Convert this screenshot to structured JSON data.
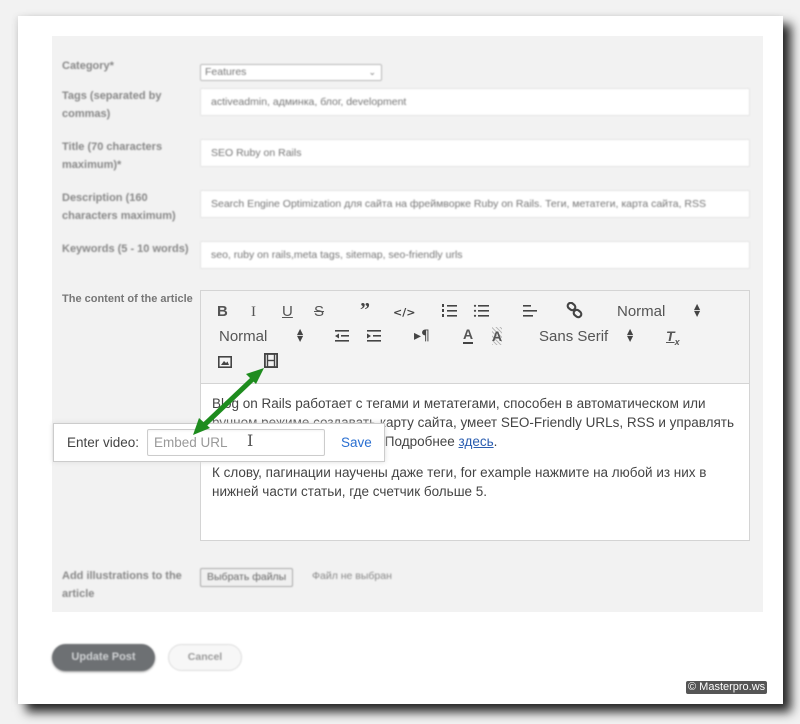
{
  "form": {
    "category": {
      "label": "Category*",
      "value": "Features"
    },
    "tags": {
      "label": "Tags (separated by commas)",
      "value": "activeadmin, админка, блог, development"
    },
    "title": {
      "label": "Title (70 characters maximum)*",
      "value": "SEO Ruby on Rails"
    },
    "description": {
      "label": "Description (160 characters maximum)",
      "value": "Search Engine Optimization для сайта на фреймворке Ruby on Rails. Теги, метатеги, карта сайта, RSS"
    },
    "keywords": {
      "label": "Keywords (5 - 10 words)",
      "value": "seo, ruby on rails,meta tags, sitemap, seo-friendly urls"
    },
    "content": {
      "label": "The content of the article"
    },
    "illustrations": {
      "label": "Add illustrations to the article",
      "button": "Выбрать файлы",
      "status": "Файл не выбран"
    }
  },
  "editor": {
    "toolbar": {
      "bold": "B",
      "italic": "I",
      "underline": "U",
      "strike": "S",
      "blockquote": "❞",
      "code": "</>",
      "header_select": "Normal",
      "size_select": "Normal",
      "font_select": "Sans Serif"
    },
    "paragraphs": [
      {
        "text": "Blog on Rails работает с тегами и метатегами, способен в автоматическом или ручном режиме создавать карту сайта, умеет SEO-Friendly URLs, RSS и управлять различными параметрами. Подробнее ",
        "link": "здесь",
        "after": "."
      },
      {
        "text": "К слову, пагинации научены даже теги, for example нажмите на любой из них в нижней части статьи, где счетчик больше 5."
      }
    ]
  },
  "video_tooltip": {
    "label": "Enter video:",
    "placeholder": "Embed URL",
    "value": "",
    "save": "Save"
  },
  "actions": {
    "update": "Update Post",
    "cancel": "Cancel"
  },
  "watermark": "© Masterpro.ws",
  "colors": {
    "annotation_arrow": "#1e8c1e",
    "link": "#2a5db0",
    "save": "#2a6fd1"
  }
}
